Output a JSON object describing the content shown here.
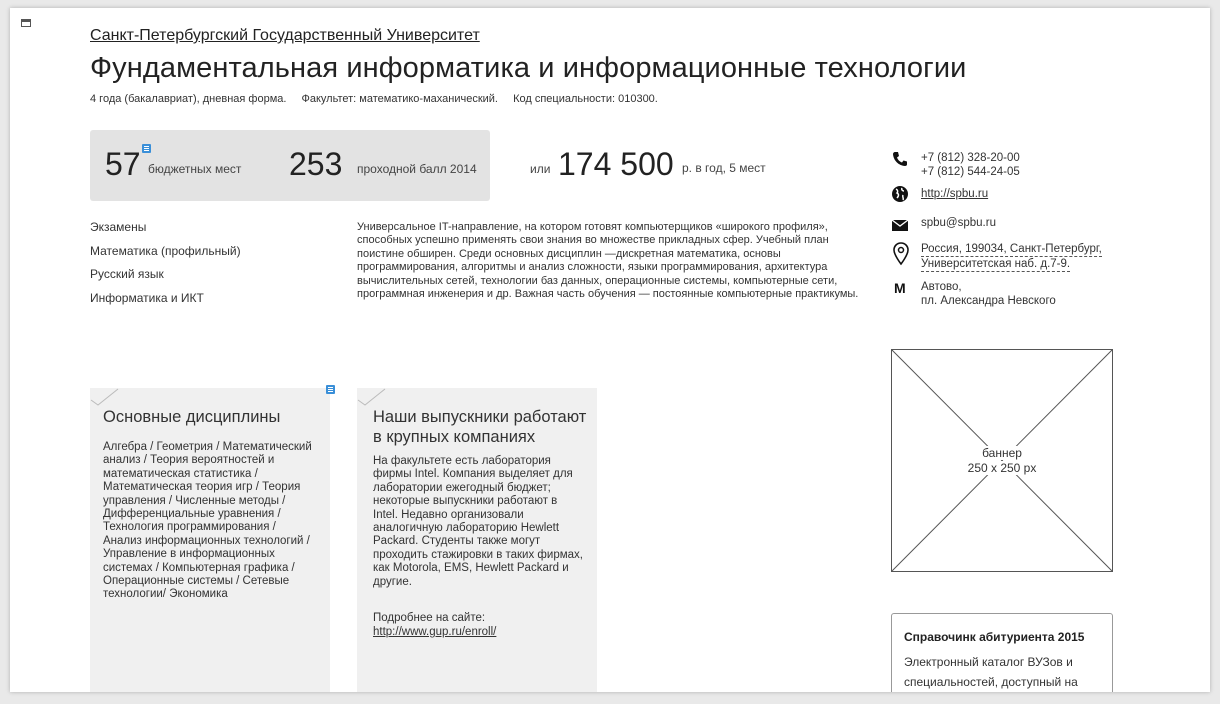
{
  "university": "Санкт-Петербургский Государственный Университет",
  "title": "Фундаментальная информатика и информационные технологии",
  "meta": {
    "duration": "4 года (бакалавриат), дневная форма.",
    "faculty": "Факультет: математико-маханический.",
    "code": "Код специальности: 010300."
  },
  "stats": {
    "budget_num": "57",
    "budget_label": "бюджетных мест",
    "score_num": "253",
    "score_label": "проходной балл 2014",
    "or": "или",
    "price_num": "174 500",
    "price_label": "р. в год, 5 мест"
  },
  "exams": {
    "title": "Экзамены",
    "items": [
      "Математика (профильный)",
      "Русский язык",
      "Информатика и ИКТ"
    ]
  },
  "description": "Универсальное IT-направление, на котором готовят компьютерщиков «широкого профиля», способных успешно применять свои знания во множестве прикладных сфер. Учебный план поистине обширен. Среди основных дисциплин —дискретная математика, основы программирования, алгоритмы и анализ сложности, языки программирования, архитектура вычислительных сетей, технологии баз данных, операционные системы, компьютерные сети, программная инженерия и др. Важная часть обучения — постоянные компьютерные практикумы.",
  "contacts": {
    "phone1": "+7 (812) 328-20-00",
    "phone2": "+7 (812) 544-24-05",
    "site": "http://spbu.ru",
    "email": "spbu@spbu.ru",
    "address1": "Россия, 199034, Санкт-Петербург,",
    "address2": "Университетская наб. д.7-9.",
    "metro_letter": "М",
    "metro1": "Автово,",
    "metro2": "пл. Александра Невского"
  },
  "card1": {
    "title": "Основные дисциплины",
    "text": "Алгебра / Геометрия / Математический анализ / Теория вероятностей и математическая статистика / Математическая теория игр / Теория управления / Численные методы / Дифференциальные уравнения / Технология программирования / Анализ информационных технологий / Управление в информационных системах / Компьютерная графика / Операционные системы / Сетевые технологии/ Экономика"
  },
  "card2": {
    "title": "Наши выпускники работают в крупных компаниях",
    "text": "На факультете есть лаборатория фирмы Intel. Компания выделяет для лаборатории ежегодный бюджет; некоторые выпускники работают в Intel. Недавно организовали аналогичную лабораторию Hewlett Packard. Студенты также могут проходить стажировки в таких фирмах, как Motorola, EMS, Hewlett Packard и другие.",
    "more_label": "Подробнее на сайте:",
    "more_link": "http://www.gup.ru/enroll/"
  },
  "banner": {
    "line1": "баннер",
    "line2": "250 x 250 px"
  },
  "guide": {
    "title": "Справочинк абитуриента 2015",
    "text": "Электронный каталог ВУЗов и специальностей, доступный на"
  }
}
